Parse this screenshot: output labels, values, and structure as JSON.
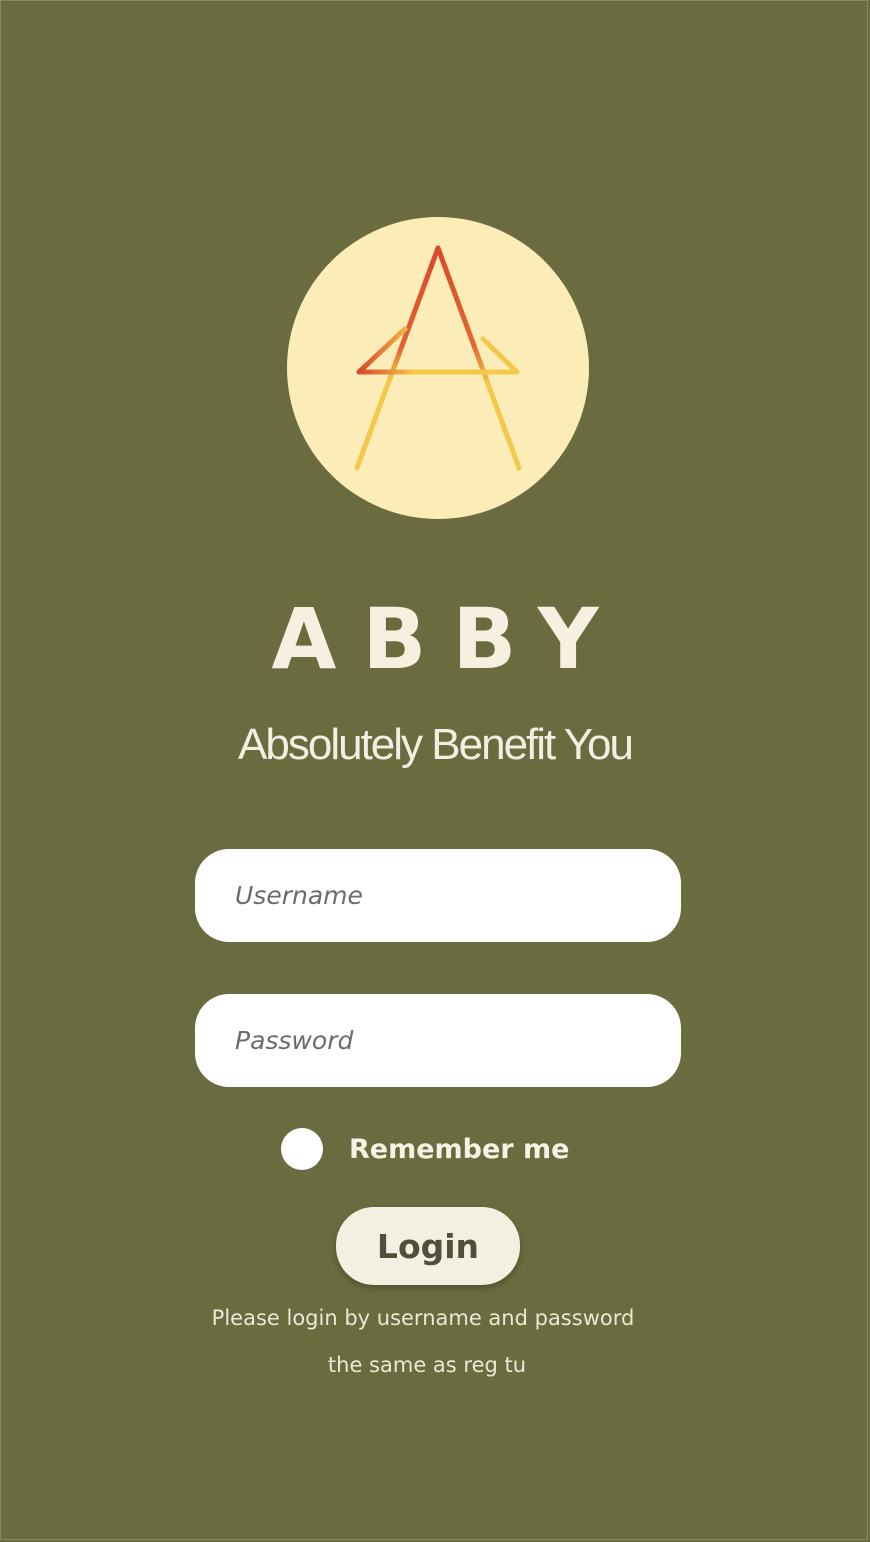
{
  "app": {
    "brand_name": "ABBY",
    "tagline": "Absolutely Benefit You",
    "logo_icon": "abby-a-logo-icon"
  },
  "colors": {
    "background": "#6a6b3f",
    "logo_circle": "#fbecb8",
    "logo_stroke_top": "#d9482a",
    "logo_stroke_bottom": "#f4c84a",
    "button_bg": "#f4f0e1"
  },
  "form": {
    "username_placeholder": "Username",
    "password_placeholder": "Password",
    "remember_label": "Remember me",
    "login_label": "Login"
  },
  "notes": {
    "line1": "Please login by username and password",
    "line2": "the same as reg tu"
  }
}
